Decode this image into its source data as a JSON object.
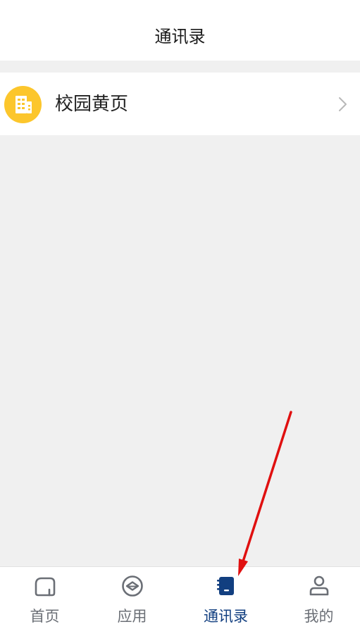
{
  "header": {
    "title": "通讯录"
  },
  "list": {
    "items": [
      {
        "label": "校园黄页",
        "icon": "building-icon",
        "icon_color": "#fcc62c"
      }
    ]
  },
  "tabbar": {
    "active_color": "#123f80",
    "inactive_color": "#6b6f76",
    "tabs": [
      {
        "label": "首页",
        "icon": "home-icon",
        "active": false
      },
      {
        "label": "应用",
        "icon": "apps-icon",
        "active": false
      },
      {
        "label": "通讯录",
        "icon": "contacts-book-icon",
        "active": true
      },
      {
        "label": "我的",
        "icon": "profile-icon",
        "active": false
      }
    ]
  },
  "annotation": {
    "arrow_color": "#e01010"
  }
}
